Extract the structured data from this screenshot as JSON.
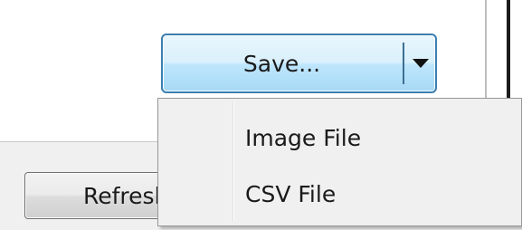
{
  "save_button": {
    "label": "Save...",
    "dropdown_icon": "chevron-down-icon"
  },
  "refresh_button": {
    "label": "Refresh"
  },
  "save_menu": {
    "items": [
      {
        "label": "Image File"
      },
      {
        "label": "CSV File"
      }
    ]
  },
  "colors": {
    "save_border": "#3c7fb1",
    "menu_background": "#f0f0f0"
  }
}
